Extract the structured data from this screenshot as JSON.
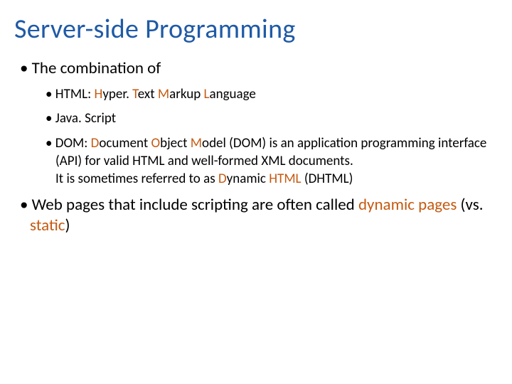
{
  "title": "Server-side Programming",
  "bullet": "• ",
  "lvl1_items": [
    {
      "text": "The combination of"
    },
    {
      "runs": [
        {
          "t": "Web pages that include scripting are often called "
        },
        {
          "t": "dynamic pages",
          "acc": true
        },
        {
          "t": " (vs. "
        },
        {
          "t": "static",
          "acc": true
        },
        {
          "t": ")"
        }
      ]
    }
  ],
  "lvl2_items": [
    {
      "runs": [
        {
          "t": "HTML: "
        },
        {
          "t": "H",
          "acc": true
        },
        {
          "t": "yper. "
        },
        {
          "t": "T",
          "acc": true
        },
        {
          "t": "ext "
        },
        {
          "t": "M",
          "acc": true
        },
        {
          "t": "arkup "
        },
        {
          "t": "L",
          "acc": true
        },
        {
          "t": "anguage"
        }
      ]
    },
    {
      "runs": [
        {
          "t": "Java. Script"
        }
      ]
    },
    {
      "runs": [
        {
          "t": "DOM: "
        },
        {
          "t": "D",
          "acc": true
        },
        {
          "t": "ocument "
        },
        {
          "t": "O",
          "acc": true
        },
        {
          "t": "bject "
        },
        {
          "t": "M",
          "acc": true
        },
        {
          "t": "odel (DOM) is an application programming interface (API) for valid HTML and well-formed XML documents."
        },
        {
          "br": true
        },
        {
          "t": "It is sometimes referred to as "
        },
        {
          "t": "D",
          "acc": true
        },
        {
          "t": "ynamic "
        },
        {
          "t": "HTML",
          "acc": true
        },
        {
          "t": " (DHTML)"
        }
      ]
    }
  ]
}
